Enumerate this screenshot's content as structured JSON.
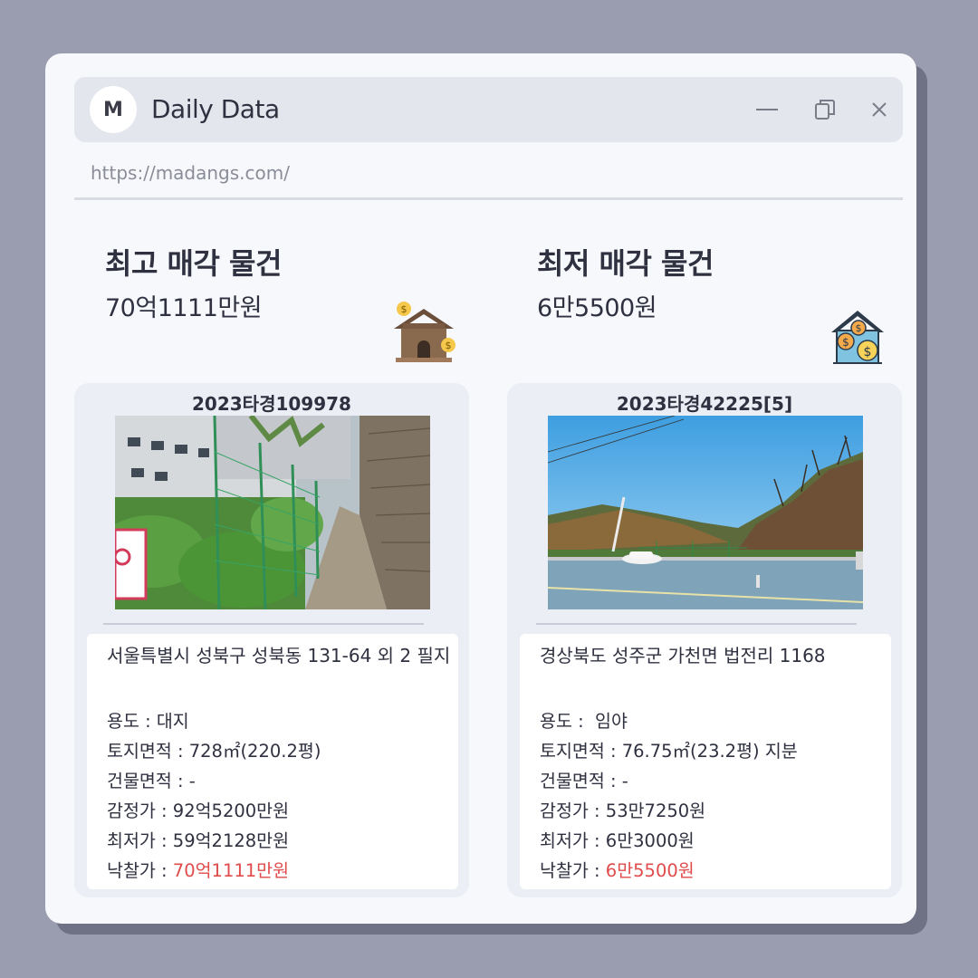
{
  "window": {
    "logo_letter": "M",
    "title": "Daily Data",
    "url": "https://madangs.com/"
  },
  "highest": {
    "label": "최고 매각 물건",
    "amount": "70억1111만원",
    "icon": "house-with-coins-icon",
    "case_no": "2023타경109978",
    "photo": "alley-with-green-fence-photo",
    "address": "서울특별시 성북구 성북동 131-64 외 2 필지",
    "rows": [
      {
        "label": "용도 : ",
        "value": "대지"
      },
      {
        "label": "토지면적 : ",
        "value": "728㎡(220.2평)"
      },
      {
        "label": "건물면적 : ",
        "value": "-"
      },
      {
        "label": "감정가 : ",
        "value": "92억5200만원"
      },
      {
        "label": "최저가 : ",
        "value": "59억2128만원"
      },
      {
        "label": "낙찰가 : ",
        "value": "70억1111만원"
      }
    ]
  },
  "lowest": {
    "label": "최저 매각 물건",
    "amount": "6만5500원",
    "icon": "house-money-icon",
    "case_no": "2023타경42225[5]",
    "photo": "roadside-forest-hill-photo",
    "address": "경상북도 성주군 가천면 법전리 1168",
    "rows": [
      {
        "label": "용도 :  ",
        "value": "임야"
      },
      {
        "label": "토지면적 : ",
        "value": "76.75㎡(23.2평) 지분"
      },
      {
        "label": "건물면적 : ",
        "value": "-"
      },
      {
        "label": "감정가 : ",
        "value": "53만7250원"
      },
      {
        "label": "최저가 : ",
        "value": "6만3000원"
      },
      {
        "label": "낙찰가 : ",
        "value": "6만5500원"
      }
    ]
  },
  "colors": {
    "accent_red": "#e04b4b",
    "background": "#9a9caf",
    "window": "#f7f8fc"
  }
}
